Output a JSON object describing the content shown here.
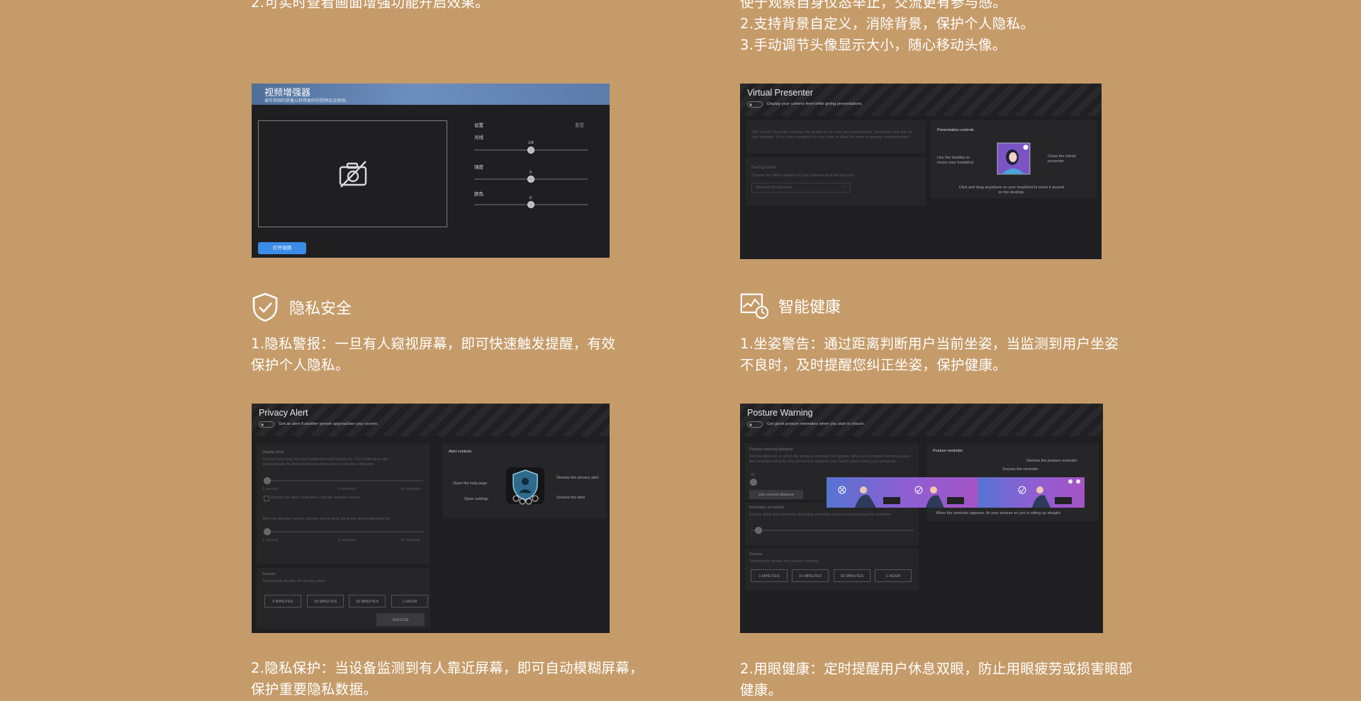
{
  "top_left": {
    "line2": "2.可实时查看画面增强功能开启效果。"
  },
  "top_right": {
    "line1": "使于观察自身仪态举止，交流更有参与感。",
    "line2": "2.支持背景自定义，消除背景，保护个人隐私。",
    "line3": "3.手动调节头像显示大小，随心移动头像。"
  },
  "video_enhancer": {
    "title": "视频增强器",
    "subtitle": "调节视频的质量以获得更好的视频会议体验。",
    "settings_label": "设置",
    "reset_label": "重置",
    "brightness_label": "光线",
    "brightness_value": "1/8",
    "intensity_label": "强度",
    "intensity_value": "0",
    "color_label": "颜色",
    "color_value": "0",
    "open_camera_button": "打开视频"
  },
  "virtual_presenter": {
    "title": "Virtual Presenter",
    "toggle_desc": "Display your camera feed while giving presentations.",
    "desc": "The Virtual Presenter overlays the image of you over any presentation, document and app on your desktop. It has been designed for use case to allow for more engaging communication.",
    "background_label": "Background",
    "background_desc": "Choose the effect applied on your camera feed background.",
    "background_select": "Remove Background",
    "controls_title": "Presentation controls",
    "handles_hint": "Use the handles to resize your headshot.",
    "close_hint": "Close the virtual presenter",
    "drag_hint": "Click and drag anywhere on your headshot to move it around on the desktop."
  },
  "privacy_section": {
    "heading": "隐私安全",
    "para1_line1": "1.隐私警报：一旦有人窥视屏幕，即可快速触发提醒，有效",
    "para1_line2": "保护个人隐私。",
    "para2_line1": "2.隐私保护：当设备监测到有人靠近屏幕，即可自动模糊屏幕，",
    "para2_line2": "保护重要隐私数据。"
  },
  "health_section": {
    "heading": "智能健康",
    "para1_line1": "1.坐姿警告：通过距离判断用户当前坐姿，当监测到用户坐姿",
    "para1_line2": "不良时，及时提醒您纠正坐姿，保护健康。",
    "para2_line1": "2.用眼健康：定时提醒用户休息双眼，防止用眼疲劳或损害眼部",
    "para2_line2": "健康。"
  },
  "privacy_alert": {
    "title": "Privacy Alert",
    "toggle_desc": "Get an alert if another person approaches your screen.",
    "display_time_label": "Display time",
    "display_time_desc": "Choose how long the alert notification will display for. The notification will automatically be dismissed when there are no intruders detected.",
    "slider_ticks": [
      "1 second",
      "5 seconds",
      "10 seconds"
    ],
    "checkbox_label": "Display the alert notification until the intruder leaves.",
    "after_leaves_desc": "After the intruder leaves, choose how long to show the alert notification for.",
    "snooze_label": "Snooze",
    "snooze_desc": "Temporarily disable the privacy alert.",
    "snooze_options": [
      "5 MINUTES",
      "15 MINUTES",
      "30 MINUTES",
      "1 HOUR"
    ],
    "snooze_button": "SNOOZE",
    "controls_title": "Alert controls",
    "open_help": "Open the help page",
    "open_settings": "Open settings",
    "dismiss": "Dismiss the privacy alert",
    "snooze_alert": "Snooze the alert"
  },
  "posture_warning": {
    "title": "Posture Warning",
    "toggle_desc": "Get good posture reminders when you start to slouch.",
    "distance_label": "Posture warning distance",
    "distance_desc": "Set the distance at which the posture reminder will appear. When your posture becomes poor, the reminder will help you correct it to improve your health when using your computer.",
    "distance_value": "30",
    "use_current": "Use current distance",
    "sensitivity_label": "Reminder sensitivity",
    "sensitivity_desc": "Set the delay time between detecting unhealthy posture and showing the reminder.",
    "snooze_label": "Snooze",
    "snooze_desc": "Temporarily disable the posture warning.",
    "snooze_options": [
      "1 MINUTES",
      "15 MINUTES",
      "30 MINUTES",
      "1 HOUR"
    ],
    "reminder_title": "Posture reminder",
    "dismiss_reminder": "Dismiss the posture reminder",
    "snooze_reminder": "Snooze the reminder",
    "reminder_hint": "When the reminder appears, fix your posture so you're sitting up straight."
  }
}
